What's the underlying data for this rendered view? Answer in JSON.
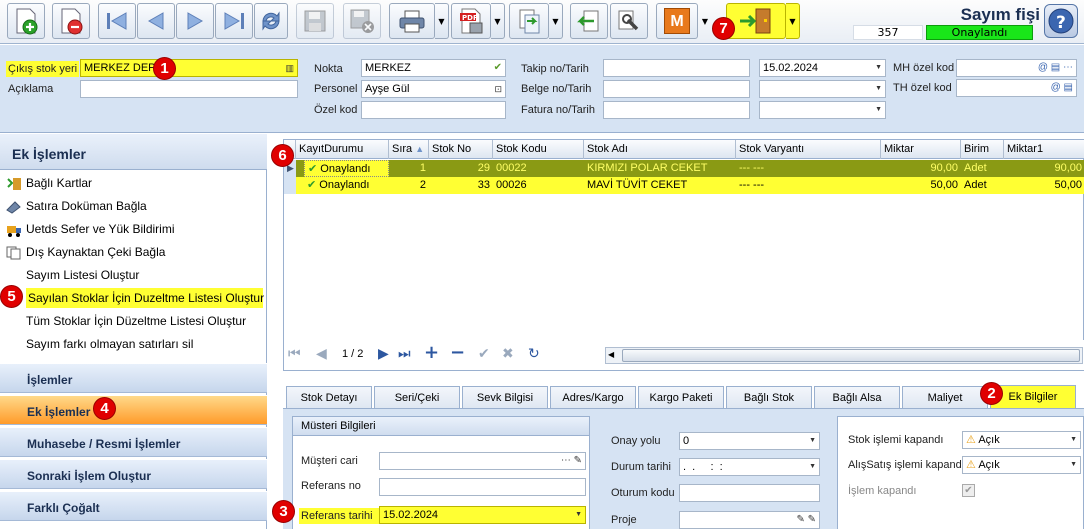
{
  "toolbar": {
    "doc_title": "Sayım fişi",
    "doc_no": "357",
    "doc_status": "Onaylandı",
    "status_color": "#19e619",
    "buttons": [
      "add-icon",
      "delete-icon",
      "first-icon",
      "prev-icon",
      "next-icon",
      "last-icon",
      "refresh-icon",
      "save-icon",
      "save-close-icon",
      "print-icon",
      "pdf-icon",
      "export-icon",
      "import-icon",
      "tools-icon",
      "m-icon",
      "exit-icon",
      "help-icon"
    ],
    "m_label": "M"
  },
  "form": {
    "cikis_label": "Çıkış stok yeri",
    "cikis_value": "MERKEZ DEPO",
    "aciklama_label": "Açıklama",
    "aciklama_value": "",
    "nokta_label": "Nokta",
    "nokta_value": "MERKEZ",
    "personel_label": "Personel",
    "personel_value": "Ayşe Gül",
    "ozel_kod_label": "Özel kod",
    "takip_label": "Takip no/Tarih",
    "takip_date": "15.02.2024",
    "belge_label": "Belge no/Tarih",
    "fatura_label": "Fatura no/Tarih",
    "mh_label": "MH özel kod",
    "th_label": "TH özel kod"
  },
  "left": {
    "header": "Ek İşlemler",
    "items": [
      {
        "label": "Bağlı Kartlar",
        "icon": "linked-cards-icon"
      },
      {
        "label": "Satıra Doküman Bağla",
        "icon": "attach-doc-icon"
      },
      {
        "label": "Uetds Sefer ve Yük Bildirimi",
        "icon": "truck-icon"
      },
      {
        "label": "Dış Kaynaktan Çeki Bağla",
        "icon": "copy-icon"
      },
      {
        "label": "Sayım Listesi Oluştur",
        "icon": ""
      },
      {
        "label": "Sayılan Stoklar İçin Duzeltme Listesi Oluştur",
        "icon": ""
      },
      {
        "label": "Tüm Stoklar İçin Düzeltme Listesi Oluştur",
        "icon": ""
      },
      {
        "label": "Sayım farkı olmayan satırları sil",
        "icon": ""
      }
    ],
    "groups": [
      "İşlemler",
      "Ek İşlemler",
      "Muhasebe / Resmi İşlemler",
      "Sonraki İşlem Oluştur",
      "Farklı Çoğalt"
    ]
  },
  "grid": {
    "columns": [
      "KayıtDurumu",
      "Sıra",
      "Stok No",
      "Stok Kodu",
      "Stok Adı",
      "Stok Varyantı",
      "Miktar",
      "Birim",
      "Miktar1"
    ],
    "rows": [
      {
        "durum": "Onaylandı",
        "sira": "1",
        "stok_no": "29",
        "stok_kodu": "00022",
        "stok_adi": "KIRMIZI POLAR CEKET",
        "varyant": "--- ---",
        "miktar": "90,00",
        "birim": "Adet",
        "miktar1": "90,00"
      },
      {
        "durum": "Onaylandı",
        "sira": "2",
        "stok_no": "33",
        "stok_kodu": "00026",
        "stok_adi": "MAVİ TÜVİT CEKET",
        "varyant": "--- ---",
        "miktar": "50,00",
        "birim": "Adet",
        "miktar1": "50,00"
      }
    ],
    "page_info": "1 / 2"
  },
  "tabs": [
    "Stok Detayı",
    "Seri/Çeki",
    "Sevk Bilgisi",
    "Adres/Kargo",
    "Kargo Paketi",
    "Bağlı Stok",
    "Bağlı Alsa",
    "Maliyet",
    "Ek Bilgiler"
  ],
  "musteri": {
    "header": "Müsteri Bilgileri",
    "cari_label": "Müşteri cari",
    "ref_no_label": "Referans no",
    "ref_tarih_label": "Referans tarihi",
    "ref_tarih_value": "15.02.2024"
  },
  "onay": {
    "onay_yolu_label": "Onay yolu",
    "onay_yolu_value": "0",
    "durum_tarihi_label": "Durum tarihi",
    "durum_tarihi_value": ".  .     :  :",
    "oturum_label": "Oturum kodu",
    "proje_label": "Proje"
  },
  "kapandi": {
    "stok_label": "Stok işlemi kapandı",
    "stok_value": "Açık",
    "alis_label": "AlışSatış işlemi kapandı",
    "alis_value": "Açık",
    "islem_label": "İşlem kapandı"
  },
  "badges": [
    "1",
    "2",
    "3",
    "4",
    "5",
    "6",
    "7"
  ]
}
